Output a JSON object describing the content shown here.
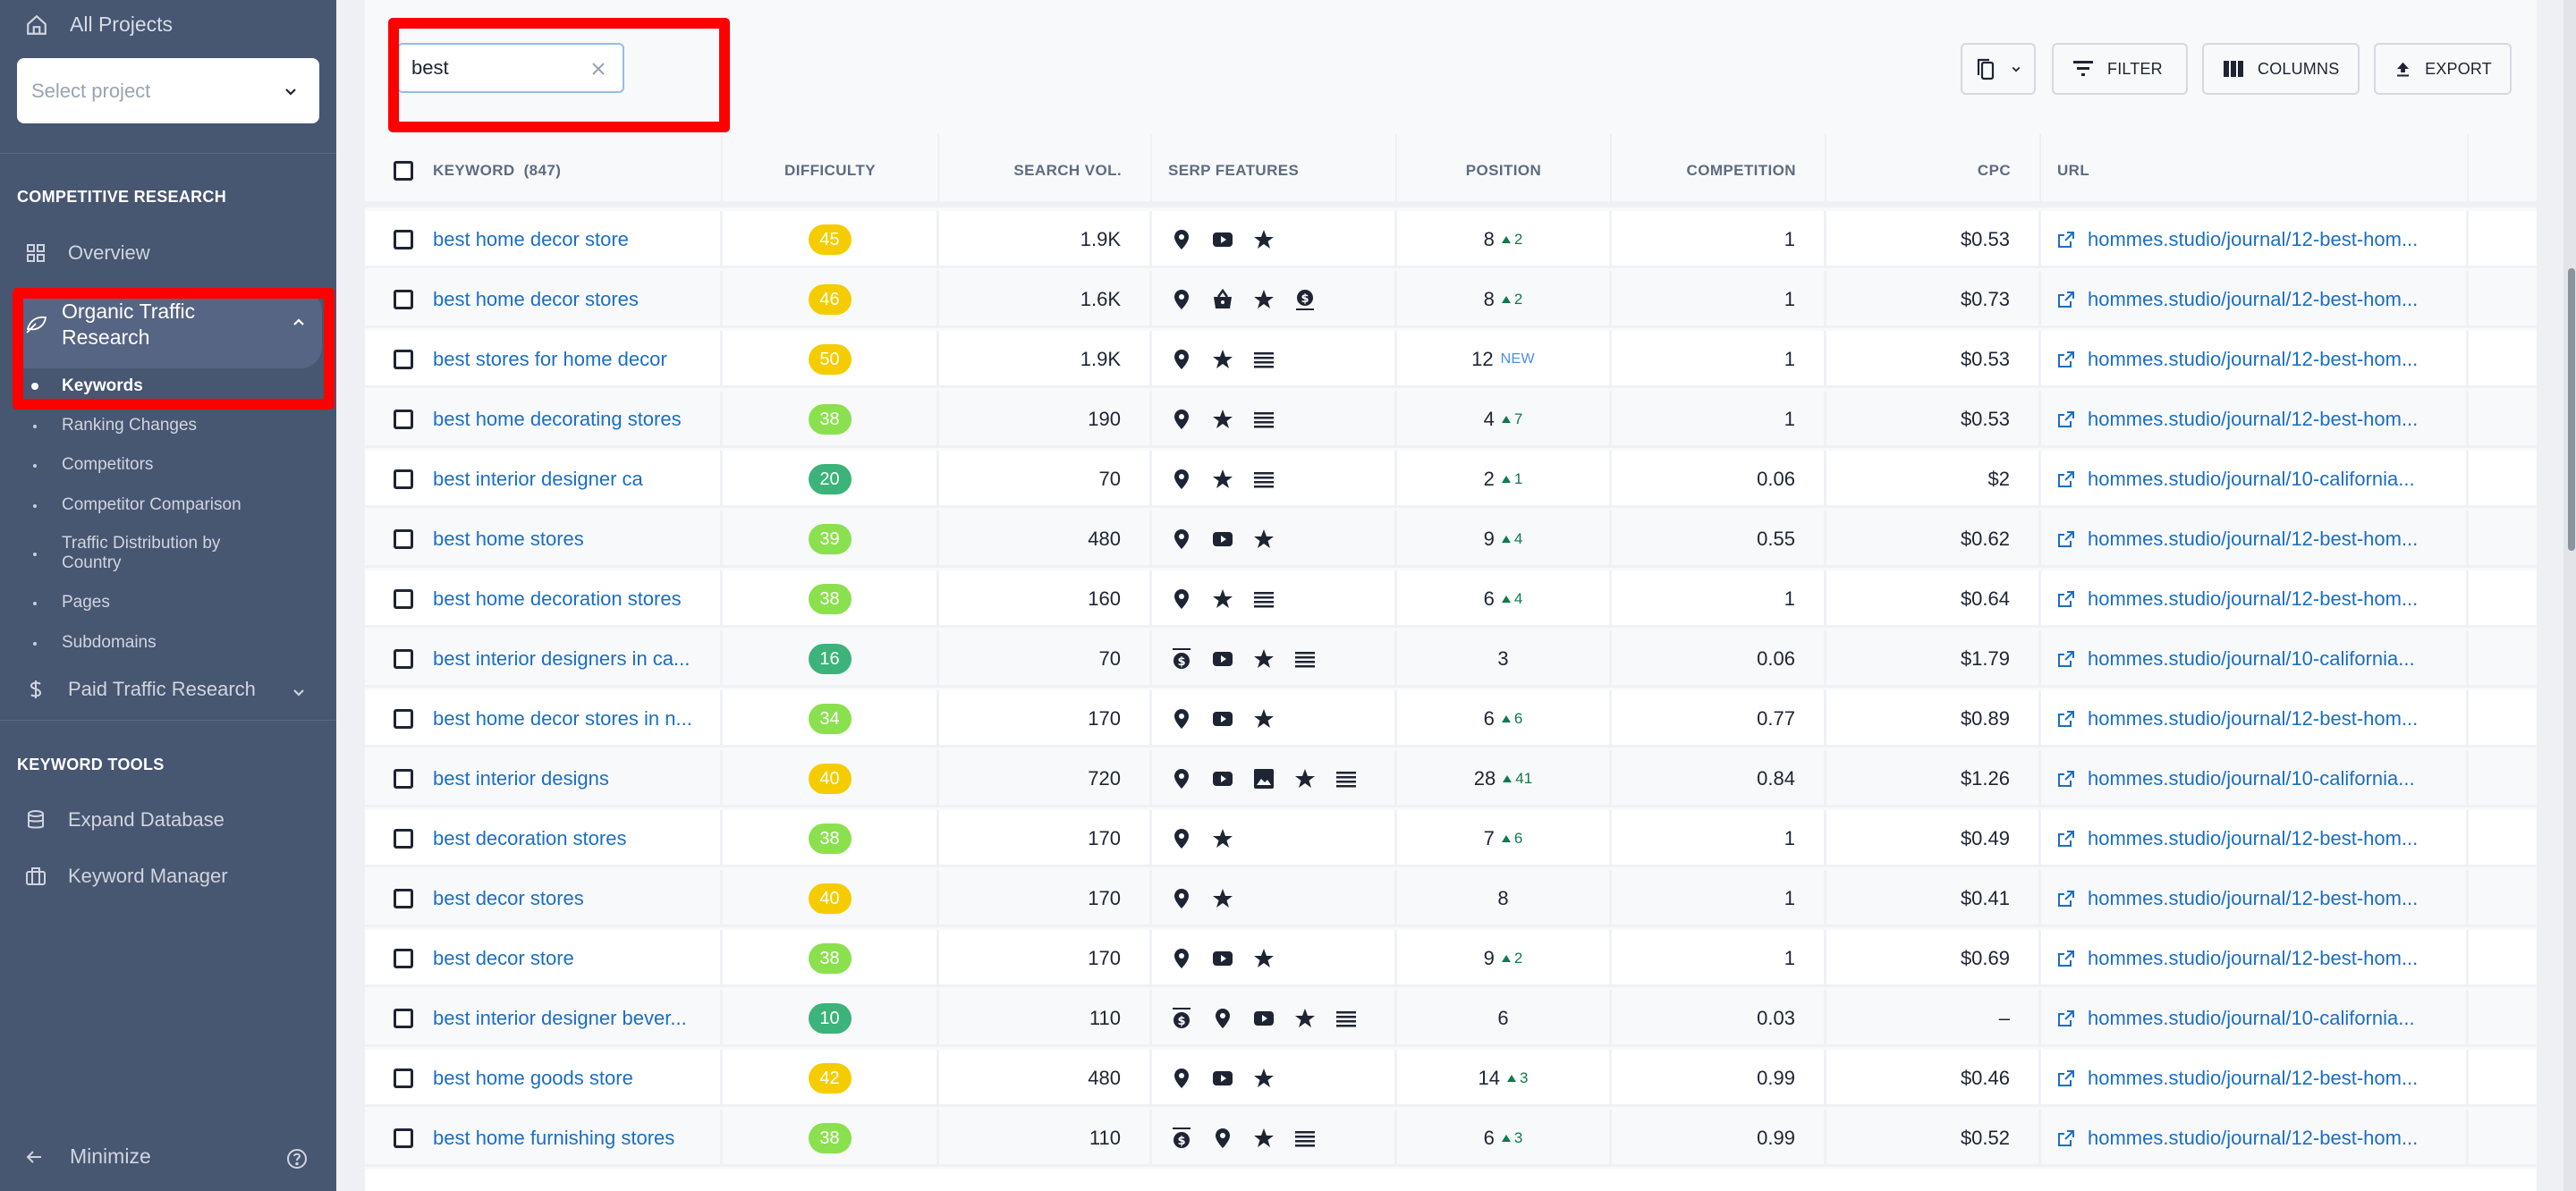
{
  "sidebar": {
    "all_projects": "All Projects",
    "select_project_placeholder": "Select project",
    "section_competitive": "COMPETITIVE RESEARCH",
    "overview": "Overview",
    "organic_group": "Organic Traffic Research",
    "organic_sub": [
      {
        "label": "Keywords",
        "active": true
      },
      {
        "label": "Ranking Changes",
        "active": false
      },
      {
        "label": "Competitors",
        "active": false
      },
      {
        "label": "Competitor Comparison",
        "active": false
      },
      {
        "label": "Traffic Distribution by Country",
        "active": false
      },
      {
        "label": "Pages",
        "active": false
      },
      {
        "label": "Subdomains",
        "active": false
      }
    ],
    "paid_group": "Paid Traffic Research",
    "section_keyword_tools": "KEYWORD TOOLS",
    "expand_database": "Expand Database",
    "keyword_manager": "Keyword Manager",
    "minimize": "Minimize"
  },
  "toolbar": {
    "search_value": "best",
    "filter_label": "FILTER",
    "columns_label": "COLUMNS",
    "export_label": "EXPORT"
  },
  "table": {
    "headers": {
      "keyword": "KEYWORD",
      "keyword_count": "(847)",
      "difficulty": "DIFFICULTY",
      "search_vol": "SEARCH VOL.",
      "serp_features": "SERP FEATURES",
      "position": "POSITION",
      "competition": "COMPETITION",
      "cpc": "CPC",
      "url": "URL"
    },
    "difficulty_colors": {
      "easy": "#3bb37a",
      "medium": "#8be04e",
      "hard": "#f5cc00"
    },
    "rows": [
      {
        "keyword": "best home decor store",
        "difficulty": 45,
        "search_vol": "1.9K",
        "serp": [
          "local-pack",
          "video",
          "reviews"
        ],
        "position": "8",
        "delta": "2",
        "new": false,
        "competition": "1",
        "cpc": "$0.53",
        "url": "hommes.studio/journal/12-best-hom..."
      },
      {
        "keyword": "best home decor stores",
        "difficulty": 46,
        "search_vol": "1.6K",
        "serp": [
          "local-pack",
          "shopping",
          "reviews",
          "bottom-ads"
        ],
        "position": "8",
        "delta": "2",
        "new": false,
        "competition": "1",
        "cpc": "$0.73",
        "url": "hommes.studio/journal/12-best-hom..."
      },
      {
        "keyword": "best stores for home decor",
        "difficulty": 50,
        "search_vol": "1.9K",
        "serp": [
          "local-pack",
          "reviews",
          "list"
        ],
        "position": "12",
        "delta": "",
        "new": true,
        "new_label": "NEW",
        "competition": "1",
        "cpc": "$0.53",
        "url": "hommes.studio/journal/12-best-hom..."
      },
      {
        "keyword": "best home decorating stores",
        "difficulty": 38,
        "search_vol": "190",
        "serp": [
          "local-pack",
          "reviews",
          "list"
        ],
        "position": "4",
        "delta": "7",
        "new": false,
        "competition": "1",
        "cpc": "$0.53",
        "url": "hommes.studio/journal/12-best-hom..."
      },
      {
        "keyword": "best interior designer ca",
        "difficulty": 20,
        "search_vol": "70",
        "serp": [
          "local-pack",
          "reviews",
          "list"
        ],
        "position": "2",
        "delta": "1",
        "new": false,
        "competition": "0.06",
        "cpc": "$2",
        "url": "hommes.studio/journal/10-california..."
      },
      {
        "keyword": "best home stores",
        "difficulty": 39,
        "search_vol": "480",
        "serp": [
          "local-pack",
          "video",
          "reviews"
        ],
        "position": "9",
        "delta": "4",
        "new": false,
        "competition": "0.55",
        "cpc": "$0.62",
        "url": "hommes.studio/journal/12-best-hom..."
      },
      {
        "keyword": "best home decoration stores",
        "difficulty": 38,
        "search_vol": "160",
        "serp": [
          "local-pack",
          "reviews",
          "list"
        ],
        "position": "6",
        "delta": "4",
        "new": false,
        "competition": "1",
        "cpc": "$0.64",
        "url": "hommes.studio/journal/12-best-hom..."
      },
      {
        "keyword": "best interior designers in ca...",
        "difficulty": 16,
        "search_vol": "70",
        "serp": [
          "top-ads",
          "video",
          "reviews",
          "list"
        ],
        "position": "3",
        "delta": "",
        "new": false,
        "competition": "0.06",
        "cpc": "$1.79",
        "url": "hommes.studio/journal/10-california..."
      },
      {
        "keyword": "best home decor stores in n...",
        "difficulty": 34,
        "search_vol": "170",
        "serp": [
          "local-pack",
          "video",
          "reviews"
        ],
        "position": "6",
        "delta": "6",
        "new": false,
        "competition": "0.77",
        "cpc": "$0.89",
        "url": "hommes.studio/journal/12-best-hom..."
      },
      {
        "keyword": "best interior designs",
        "difficulty": 40,
        "search_vol": "720",
        "serp": [
          "local-pack",
          "video",
          "images",
          "reviews",
          "list"
        ],
        "position": "28",
        "delta": "41",
        "new": false,
        "competition": "0.84",
        "cpc": "$1.26",
        "url": "hommes.studio/journal/10-california..."
      },
      {
        "keyword": "best decoration stores",
        "difficulty": 38,
        "search_vol": "170",
        "serp": [
          "local-pack",
          "reviews"
        ],
        "position": "7",
        "delta": "6",
        "new": false,
        "competition": "1",
        "cpc": "$0.49",
        "url": "hommes.studio/journal/12-best-hom..."
      },
      {
        "keyword": "best decor stores",
        "difficulty": 40,
        "search_vol": "170",
        "serp": [
          "local-pack",
          "reviews"
        ],
        "position": "8",
        "delta": "",
        "new": false,
        "competition": "1",
        "cpc": "$0.41",
        "url": "hommes.studio/journal/12-best-hom..."
      },
      {
        "keyword": "best decor store",
        "difficulty": 38,
        "search_vol": "170",
        "serp": [
          "local-pack",
          "video",
          "reviews"
        ],
        "position": "9",
        "delta": "2",
        "new": false,
        "competition": "1",
        "cpc": "$0.69",
        "url": "hommes.studio/journal/12-best-hom..."
      },
      {
        "keyword": "best interior designer bever...",
        "difficulty": 10,
        "search_vol": "110",
        "serp": [
          "top-ads",
          "local-pack",
          "video",
          "reviews",
          "list"
        ],
        "position": "6",
        "delta": "",
        "new": false,
        "competition": "0.03",
        "cpc": "–",
        "url": "hommes.studio/journal/10-california..."
      },
      {
        "keyword": "best home goods store",
        "difficulty": 42,
        "search_vol": "480",
        "serp": [
          "local-pack",
          "video",
          "reviews"
        ],
        "position": "14",
        "delta": "3",
        "new": false,
        "competition": "0.99",
        "cpc": "$0.46",
        "url": "hommes.studio/journal/12-best-hom..."
      },
      {
        "keyword": "best home furnishing stores",
        "difficulty": 38,
        "search_vol": "110",
        "serp": [
          "top-ads",
          "local-pack",
          "reviews",
          "list"
        ],
        "position": "6",
        "delta": "3",
        "new": false,
        "competition": "0.99",
        "cpc": "$0.52",
        "url": "hommes.studio/journal/12-best-hom..."
      }
    ]
  }
}
